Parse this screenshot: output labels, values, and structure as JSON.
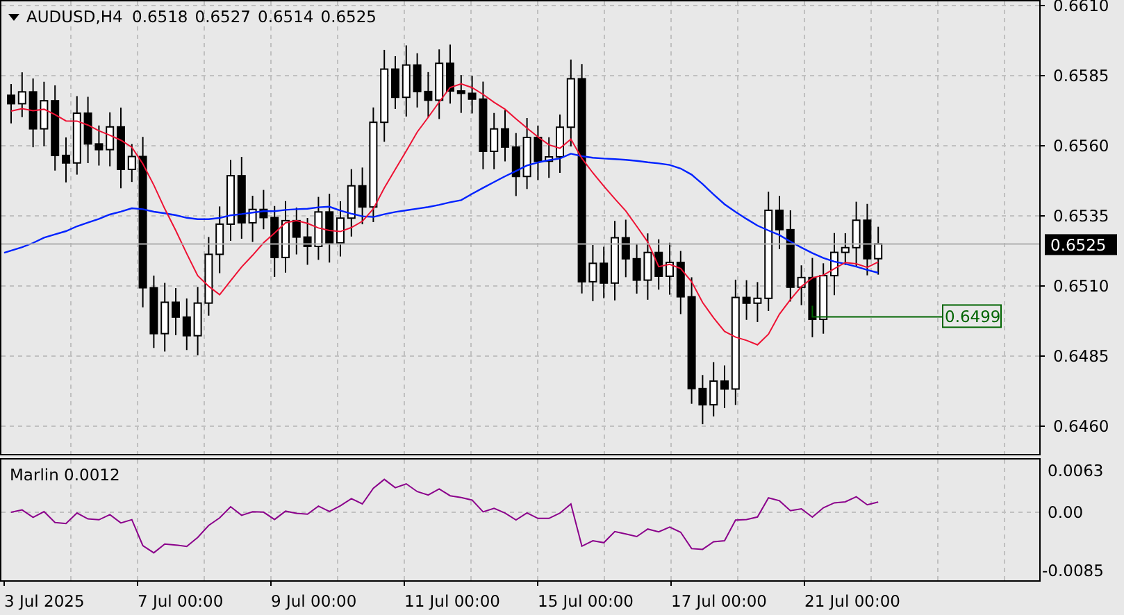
{
  "header": {
    "symbol": "AUDUSD,H4",
    "ohlc": [
      "0.6518",
      "0.6527",
      "0.6514",
      "0.6525"
    ]
  },
  "price_axis": [
    "0.6610",
    "0.6585",
    "0.6560",
    "0.6535",
    "0.6510",
    "0.6485",
    "0.6460"
  ],
  "current_price": "0.6525",
  "level_label": "0.6499",
  "indicator": {
    "title": "Marlin 0.0012",
    "axis": [
      "0.0063",
      "0.00",
      "-0.0085"
    ]
  },
  "time_axis": [
    "3 Jul 2025",
    "7 Jul 00:00",
    "9 Jul 00:00",
    "11 Jul 00:00",
    "15 Jul 00:00",
    "17 Jul 00:00",
    "21 Jul 00:00"
  ]
}
